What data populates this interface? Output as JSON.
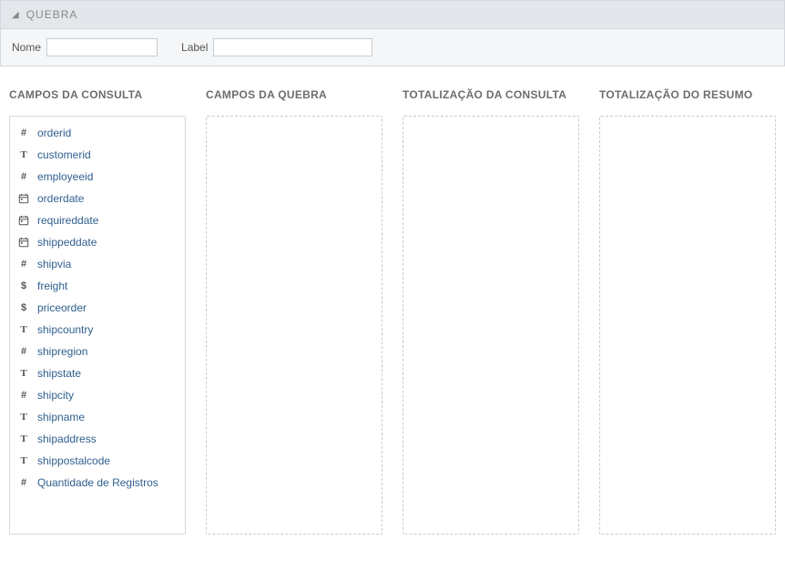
{
  "panel": {
    "title": "QUEBRA"
  },
  "form": {
    "nome_label": "Nome",
    "nome_value": "",
    "label_label": "Label",
    "label_value": ""
  },
  "columns": [
    {
      "title": "CAMPOS DA CONSULTA"
    },
    {
      "title": "CAMPOS DA QUEBRA"
    },
    {
      "title": "TOTALIZAÇÃO DA CONSULTA"
    },
    {
      "title": "TOTALIZAÇÃO DO RESUMO"
    }
  ],
  "fields": [
    {
      "type": "number",
      "label": "orderid"
    },
    {
      "type": "text",
      "label": "customerid"
    },
    {
      "type": "number",
      "label": "employeeid"
    },
    {
      "type": "date",
      "label": "orderdate"
    },
    {
      "type": "date",
      "label": "requireddate"
    },
    {
      "type": "date",
      "label": "shippeddate"
    },
    {
      "type": "number",
      "label": "shipvia"
    },
    {
      "type": "currency",
      "label": "freight"
    },
    {
      "type": "currency",
      "label": "priceorder"
    },
    {
      "type": "text",
      "label": "shipcountry"
    },
    {
      "type": "number",
      "label": "shipregion"
    },
    {
      "type": "text",
      "label": "shipstate"
    },
    {
      "type": "number",
      "label": "shipcity"
    },
    {
      "type": "text",
      "label": "shipname"
    },
    {
      "type": "text",
      "label": "shipaddress"
    },
    {
      "type": "text",
      "label": "shippostalcode"
    },
    {
      "type": "number",
      "label": "Quantidade de Registros"
    }
  ]
}
